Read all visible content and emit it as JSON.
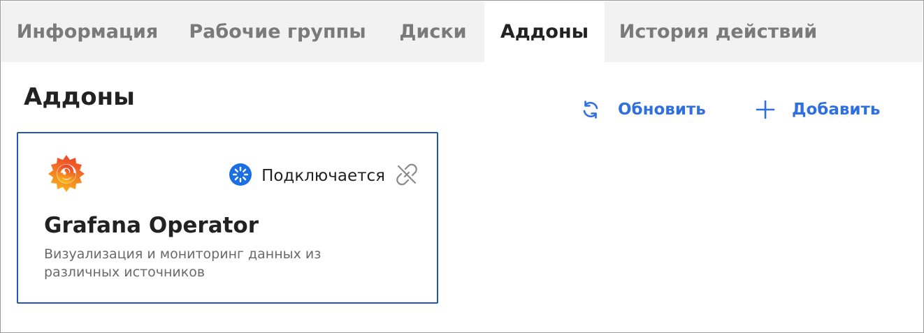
{
  "tabs": [
    {
      "label": "Информация",
      "active": false
    },
    {
      "label": "Рабочие группы",
      "active": false
    },
    {
      "label": "Диски",
      "active": false
    },
    {
      "label": "Аддоны",
      "active": true
    },
    {
      "label": "История действий",
      "active": false
    }
  ],
  "page": {
    "title": "Аддоны",
    "refresh_label": "Обновить",
    "add_label": "Добавить"
  },
  "addon": {
    "name": "Grafana Operator",
    "description": "Визуализация и мониторинг данных из различных источников",
    "status": "Подключается",
    "logo_icon": "grafana-logo",
    "status_icon": "loading-spinner-icon",
    "unlink_icon": "unlink-icon"
  },
  "colors": {
    "accent": "#2f6fe0",
    "card_border": "#1f5aa8",
    "tab_bar": "#f2f2f2",
    "status_icon": "#1a6fe6"
  }
}
